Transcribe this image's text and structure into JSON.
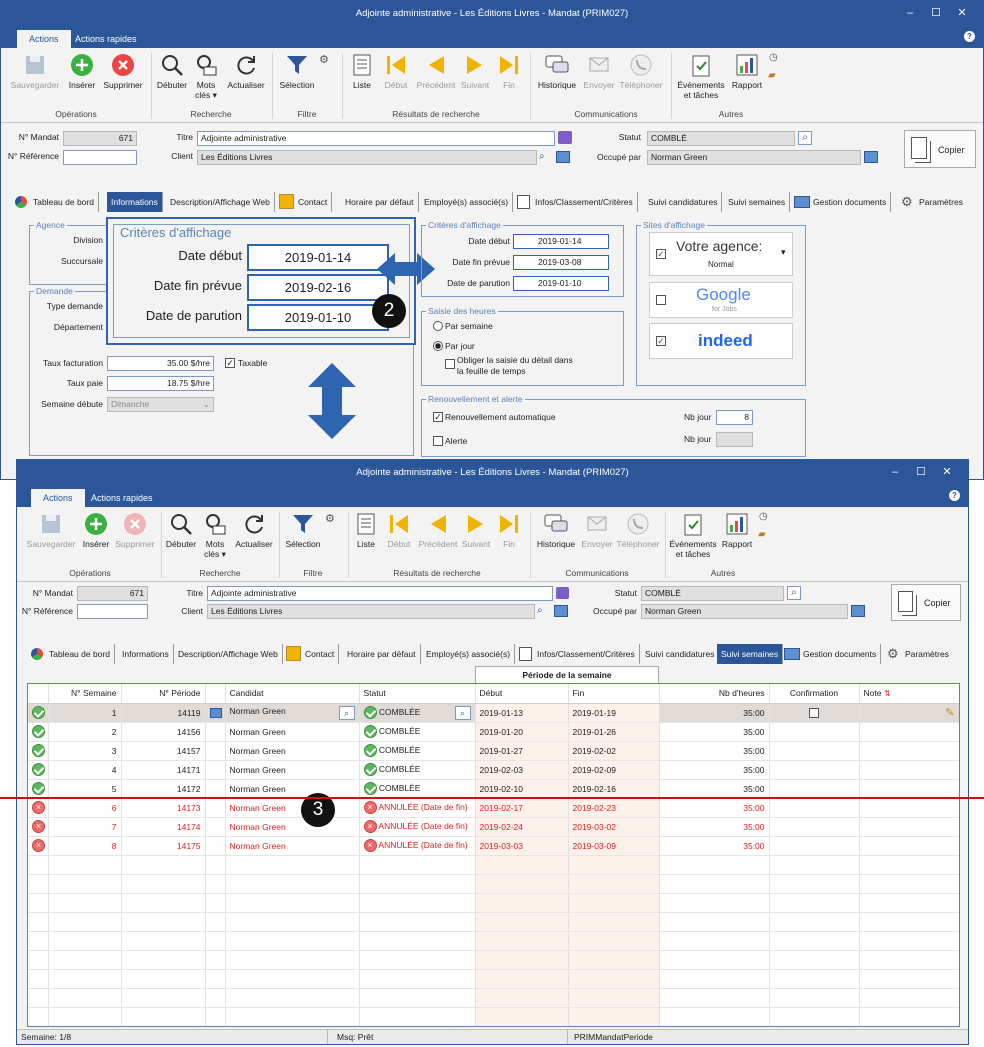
{
  "win1": {
    "title": "Adjointe administrative - Les Éditions Livres - Mandat (PRIM027)",
    "tabs": [
      "Actions",
      "Actions rapides"
    ]
  },
  "win2": {
    "title": "Adjointe administrative - Les Éditions Livres - Mandat (PRIM027)",
    "tabs": [
      "Actions",
      "Actions rapides"
    ]
  },
  "ribbon": {
    "save": "Sauvegarder",
    "insert": "Insérer",
    "delete": "Supprimer",
    "start": "Débuter",
    "keywords1": "Mots",
    "keywords2": "clés ▾",
    "refresh": "Actualiser",
    "selection": "Sélection",
    "list": "Liste",
    "first": "Début",
    "prev": "Précédent",
    "next": "Suivant",
    "end": "Fin",
    "history": "Historique",
    "send": "Envoyer",
    "phone": "Téléphoner",
    "events1": "Événements",
    "events2": "et tâches",
    "report": "Rapport",
    "groups": [
      "Opérations",
      "Recherche",
      "Filtre",
      "Résultats de recherche",
      "Communications",
      "Autres"
    ]
  },
  "header": {
    "mandat_label": "N° Mandat",
    "mandat_value": "671",
    "ref_label": "N° Référence",
    "ref_value": "",
    "title_label": "Titre",
    "title_value": "Adjointe administrative",
    "client_label": "Client",
    "client_value": "Les Éditions Livres",
    "status_label": "Statut",
    "status_value": "COMBLÉ",
    "filled_label": "Occupé par",
    "filled_value": "Norman Green",
    "copy": "Copier"
  },
  "tabs1": [
    "Tableau de bord",
    "Informations",
    "Description/Affichage Web",
    "Contact",
    "Horaire par défaut",
    "Employé(s) associé(s)",
    "Infos/Classement/Critères",
    "Suivi candidatures",
    "Suivi semaines",
    "Gestion documents",
    "Paramètres"
  ],
  "info": {
    "agence": "Agence",
    "division": "Division",
    "succursale": "Succursale",
    "demande": "Demande",
    "type_demande": "Type demande",
    "departement": "Département",
    "taux_fact_label": "Taux facturation",
    "taux_fact": "35.00 $/hre",
    "taxable": "Taxable",
    "taux_paie_label": "Taux paie",
    "taux_paie": "18.75 $/hre",
    "semaine_label": "Semaine débute",
    "semaine": "Dimanche"
  },
  "zoom": {
    "title": "Critères d'affichage",
    "date_debut_label": "Date début",
    "date_debut": "2019-01-14",
    "date_fin_label": "Date fin prévue",
    "date_fin": "2019-02-16",
    "date_parution_label": "Date de parution",
    "date_parution": "2019-01-10"
  },
  "criteres": {
    "title": "Critères d'affichage",
    "date_debut_label": "Date début",
    "date_debut": "2019-01-14",
    "date_fin_label": "Date fin prévue",
    "date_fin": "2019-03-08",
    "date_parution_label": "Date de parution",
    "date_parution": "2019-01-10"
  },
  "saisie": {
    "title": "Saisie des heures",
    "par_semaine": "Par semaine",
    "par_jour": "Par jour",
    "obliger1": "Obliger la saisie du détail dans",
    "obliger2": "la feuille de temps"
  },
  "sites": {
    "title": "Sites d'affichage",
    "agence": "Votre agence:",
    "agence_sub": "Normal",
    "google": "Google",
    "google_sub": "for Jobs",
    "indeed": "indeed"
  },
  "renouv": {
    "title": "Renouvellement et alerte",
    "auto": "Renouvellement automatique",
    "alerte": "Alerte",
    "nb_jour1": "Nb jour",
    "nb_jour2": "Nb jour",
    "nb_value": "8"
  },
  "badges": {
    "b2": "2",
    "b3": "3"
  },
  "grid": {
    "period_header": "Période de la semaine",
    "columns": [
      "N° Semaine",
      "N° Période",
      "Candidat",
      "Statut",
      "Début",
      "Fin",
      "Nb d'heures",
      "Confirmation",
      "Note"
    ],
    "rows": [
      {
        "sem": "1",
        "per": "14119",
        "cand": "Norman Green",
        "stat": "COMBLÉE",
        "deb": "2019-01-13",
        "fin": "2019-01-19",
        "hrs": "35:00"
      },
      {
        "sem": "2",
        "per": "14156",
        "cand": "Norman Green",
        "stat": "COMBLÉE",
        "deb": "2019-01-20",
        "fin": "2019-01-26",
        "hrs": "35:00"
      },
      {
        "sem": "3",
        "per": "14157",
        "cand": "Norman Green",
        "stat": "COMBLÉE",
        "deb": "2019-01-27",
        "fin": "2019-02-02",
        "hrs": "35:00"
      },
      {
        "sem": "4",
        "per": "14171",
        "cand": "Norman Green",
        "stat": "COMBLÉE",
        "deb": "2019-02-03",
        "fin": "2019-02-09",
        "hrs": "35:00"
      },
      {
        "sem": "5",
        "per": "14172",
        "cand": "Norman Green",
        "stat": "COMBLÉE",
        "deb": "2019-02-10",
        "fin": "2019-02-16",
        "hrs": "35:00"
      },
      {
        "sem": "6",
        "per": "14173",
        "cand": "Norman Green",
        "stat": "ANNULÉE (Date de fin)",
        "deb": "2019-02-17",
        "fin": "2019-02-23",
        "hrs": "35:00"
      },
      {
        "sem": "7",
        "per": "14174",
        "cand": "Norman Green",
        "stat": "ANNULÉE (Date de fin)",
        "deb": "2019-02-24",
        "fin": "2019-03-02",
        "hrs": "35:00"
      },
      {
        "sem": "8",
        "per": "14175",
        "cand": "Norman Green",
        "stat": "ANNULÉE (Date de fin)",
        "deb": "2019-03-03",
        "fin": "2019-03-09",
        "hrs": "35:00"
      }
    ]
  },
  "status": {
    "semaine": "Semaine: 1/8",
    "msg": "Msq: Prêt",
    "form": "PRIMMandatPeriode"
  },
  "colors": {
    "blue": "#2b579a",
    "red": "#e02020",
    "accent": "#2e64b0"
  }
}
